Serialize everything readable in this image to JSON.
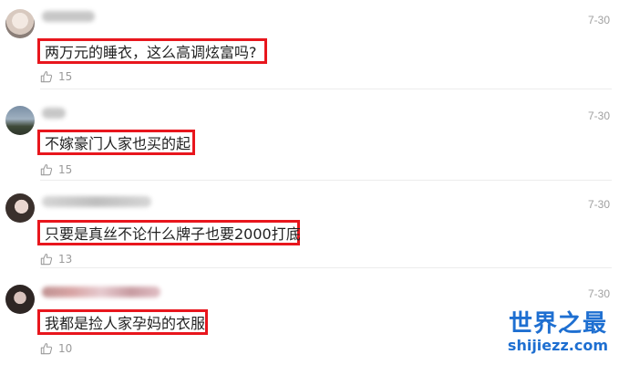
{
  "comments": [
    {
      "text": "两万元的睡衣，这么高调炫富吗?",
      "date": "7-30",
      "likes": "15"
    },
    {
      "text": "不嫁豪门人家也买的起",
      "date": "7-30",
      "likes": "15"
    },
    {
      "text": "只要是真丝不论什么牌子也要2000打底",
      "date": "7-30",
      "likes": "13"
    },
    {
      "text": "我都是捡人家孕妈的衣服",
      "date": "7-30",
      "likes": "10"
    }
  ],
  "watermark": {
    "title": "世界之最",
    "url": "shijiezz.com"
  },
  "colors": {
    "highlight": "#e8161d",
    "watermark": "#1e6fd1",
    "meta": "#a0a0a0"
  },
  "icons": {
    "like": "thumbs-up-icon"
  }
}
